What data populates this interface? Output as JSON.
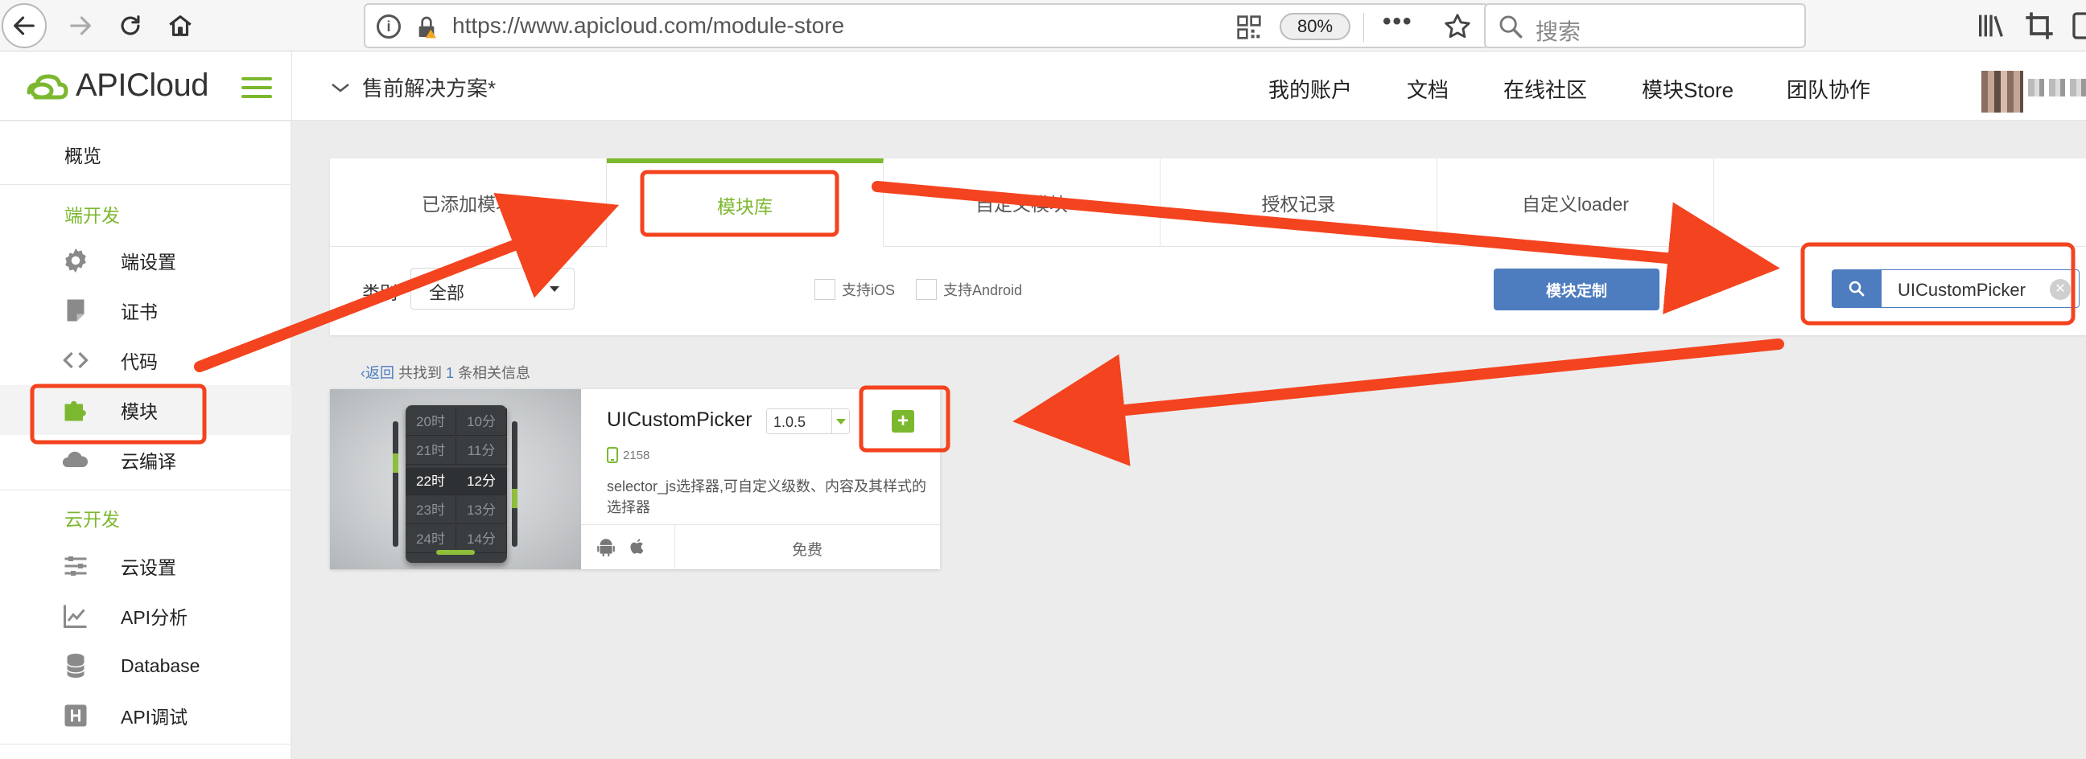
{
  "browser": {
    "url": "https://www.apicloud.com/module-store",
    "zoom": "80%",
    "search_placeholder": "搜索"
  },
  "header": {
    "logo_text": "APICloud",
    "project": "售前解决方案*",
    "nav": [
      "我的账户",
      "文档",
      "在线社区",
      "模块Store",
      "团队协作"
    ]
  },
  "sidebar": {
    "overview": "概览",
    "section_client": "端开发",
    "client_items": [
      {
        "label": "端设置",
        "icon": "gear-icon"
      },
      {
        "label": "证书",
        "icon": "certificate-icon"
      },
      {
        "label": "代码",
        "icon": "code-icon"
      },
      {
        "label": "模块",
        "icon": "puzzle-icon"
      },
      {
        "label": "云编译",
        "icon": "cloud-icon"
      }
    ],
    "section_cloud": "云开发",
    "cloud_items": [
      {
        "label": "云设置",
        "icon": "sliders-icon"
      },
      {
        "label": "API分析",
        "icon": "chart-icon"
      },
      {
        "label": "Database",
        "icon": "database-icon"
      },
      {
        "label": "API调试",
        "icon": "debug-icon"
      }
    ]
  },
  "tabs": [
    "已添加模块",
    "模块库",
    "自定义模块",
    "授权记录",
    "自定义loader"
  ],
  "filters": {
    "category_label": "类别",
    "category_value": "全部",
    "ios_label": "支持iOS",
    "android_label": "支持Android",
    "custom_button": "模块定制",
    "search_value": "UICustomPicker"
  },
  "results": {
    "back": "返回",
    "found_prefix": "共找到",
    "count": "1",
    "found_suffix": "条相关信息"
  },
  "module": {
    "name": "UICustomPicker",
    "version": "1.0.5",
    "downloads": "2158",
    "description": "selector_js选择器,可自定义级数、内容及其样式的选择器",
    "price": "免费",
    "picker_rows": [
      [
        "20时",
        "10分"
      ],
      [
        "21时",
        "11分"
      ],
      [
        "22时",
        "12分"
      ],
      [
        "23时",
        "13分"
      ],
      [
        "24时",
        "14分"
      ]
    ],
    "selected_row": 2
  },
  "colors": {
    "accent_green": "#7cb82f",
    "primary_blue": "#4d7cbf",
    "annotation_red": "#f4431f"
  }
}
